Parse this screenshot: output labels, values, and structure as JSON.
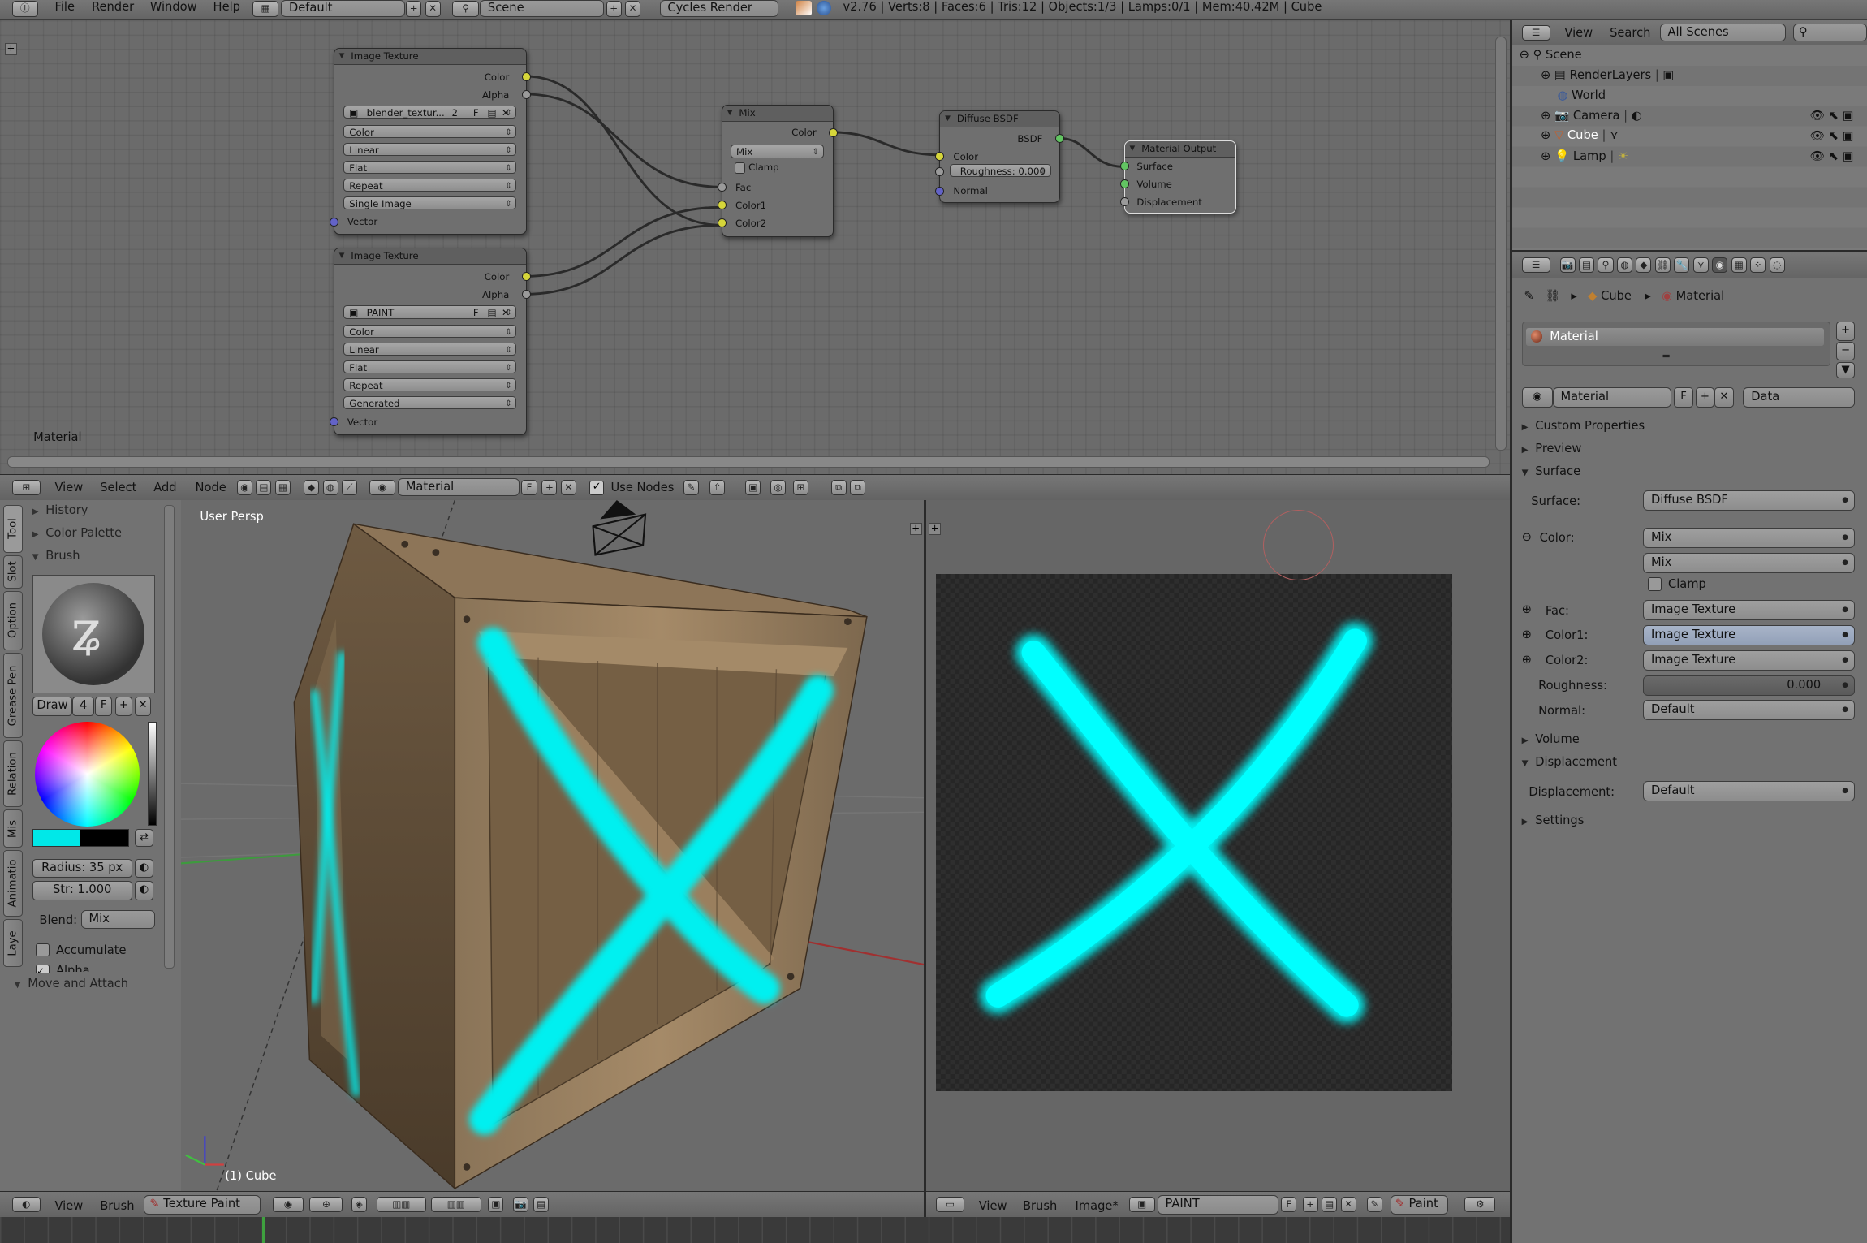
{
  "info_bar": {
    "menus": [
      "File",
      "Render",
      "Window",
      "Help"
    ],
    "screen_layout": "Default",
    "scene": "Scene",
    "render_engine": "Cycles Render",
    "stats": "v2.76 | Verts:8 | Faces:6 | Tris:12 | Objects:1/3 | Lamps:0/1 | Mem:40.42M | Cube"
  },
  "node_editor": {
    "label": "Material",
    "nodes": {
      "image_texture_1": {
        "title": "Image Texture",
        "out_color": "Color",
        "out_alpha": "Alpha",
        "image": "blender_textur...",
        "users": "2",
        "fake": "F",
        "color_space": "Color",
        "interpolation": "Linear",
        "projection": "Flat",
        "extension": "Repeat",
        "source": "Single Image",
        "in_vector": "Vector"
      },
      "image_texture_2": {
        "title": "Image Texture",
        "out_color": "Color",
        "out_alpha": "Alpha",
        "image": "PAINT",
        "fake": "F",
        "color_space": "Color",
        "interpolation": "Linear",
        "projection": "Flat",
        "extension": "Repeat",
        "source": "Generated",
        "in_vector": "Vector"
      },
      "mix": {
        "title": "Mix",
        "out_color": "Color",
        "blend": "Mix",
        "clamp": "Clamp",
        "in_fac": "Fac",
        "in_color1": "Color1",
        "in_color2": "Color2"
      },
      "diffuse": {
        "title": "Diffuse BSDF",
        "out_bsdf": "BSDF",
        "in_color": "Color",
        "roughness": "Roughness: 0.000",
        "in_normal": "Normal"
      },
      "output": {
        "title": "Material Output",
        "in_surface": "Surface",
        "in_volume": "Volume",
        "in_displacement": "Displacement"
      }
    },
    "header": {
      "menus": [
        "View",
        "Select",
        "Add",
        "Node"
      ],
      "material": "Material",
      "fake": "F",
      "use_nodes": "Use Nodes"
    }
  },
  "tool_panel": {
    "tabs": [
      "Tool",
      "Slot",
      "Option",
      "Grease Pen",
      "Relation",
      "Mis",
      "Animatio",
      "Laye"
    ],
    "sections": {
      "history": "History",
      "color_palette": "Color Palette",
      "brush": "Brush",
      "move_attach": "Move and Attach"
    },
    "brush": {
      "name": "Draw",
      "users": "4",
      "fake": "F",
      "radius": "Radius: 35 px",
      "strength": "Str: 1.000",
      "blend_label": "Blend:",
      "blend": "Mix",
      "accumulate": "Accumulate",
      "alpha": "Alpha"
    },
    "colors": {
      "primary": "#00e8e8",
      "secondary": "#000000"
    }
  },
  "viewport": {
    "label": "User Persp",
    "object": "(1) Cube",
    "header": {
      "menus": [
        "View",
        "Brush"
      ],
      "mode": "Texture Paint"
    }
  },
  "image_editor": {
    "header": {
      "menus": [
        "View",
        "Brush",
        "Image*"
      ],
      "image": "PAINT",
      "fake": "F",
      "mode": "Paint"
    }
  },
  "outliner": {
    "menus": [
      "View",
      "Search"
    ],
    "filter": "All Scenes",
    "items": [
      "Scene",
      "RenderLayers",
      "World",
      "Camera",
      "Cube",
      "Lamp"
    ]
  },
  "properties": {
    "breadcrumb": [
      "Cube",
      "Material"
    ],
    "slot": "Material",
    "material": "Material",
    "fake": "F",
    "link": "Data",
    "sections": {
      "custom": "Custom Properties",
      "preview": "Preview",
      "surface": "Surface",
      "volume": "Volume",
      "displacement": "Displacement",
      "settings": "Settings"
    },
    "surface": {
      "surface_label": "Surface:",
      "surface": "Diffuse BSDF",
      "color_label": "Color:",
      "color": "Mix",
      "blend": "Mix",
      "clamp": "Clamp",
      "fac_label": "Fac:",
      "fac": "Image Texture",
      "color1_label": "Color1:",
      "color1": "Image Texture",
      "color2_label": "Color2:",
      "color2": "Image Texture",
      "roughness_label": "Roughness:",
      "roughness": "0.000",
      "normal_label": "Normal:",
      "normal": "Default"
    },
    "displacement": {
      "label": "Displacement:",
      "value": "Default"
    }
  }
}
